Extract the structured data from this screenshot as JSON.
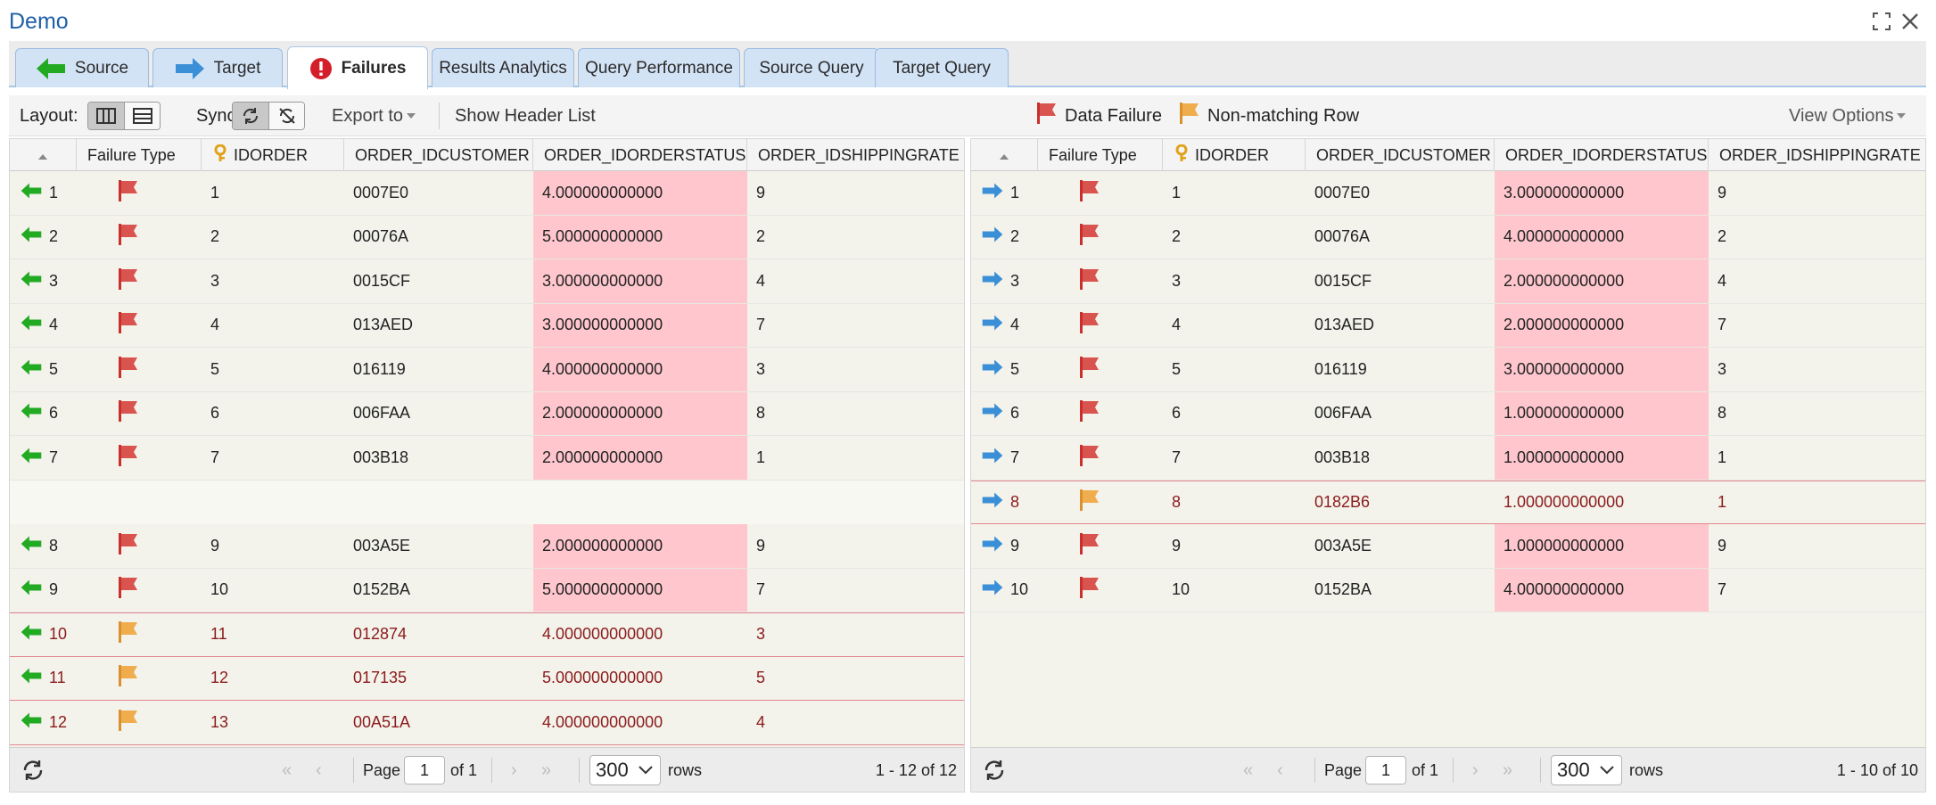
{
  "window": {
    "title": "Demo"
  },
  "tabs": [
    {
      "label": "Source",
      "icon": "arrow-left-green-icon"
    },
    {
      "label": "Target",
      "icon": "arrow-right-blue-icon"
    },
    {
      "label": "Failures",
      "icon": "alert-red-icon",
      "active": true
    },
    {
      "label": "Results Analytics"
    },
    {
      "label": "Query Performance"
    },
    {
      "label": "Source Query"
    },
    {
      "label": "Target Query"
    }
  ],
  "toolbar": {
    "layout_label": "Layout:",
    "sync_label": "Sync:",
    "export_label": "Export to",
    "show_header_label": "Show Header List",
    "legend_data_failure": "Data Failure",
    "legend_nonmatching": "Non-matching Row",
    "view_options_label": "View Options"
  },
  "colors": {
    "data_failure_flag": "#d9534f",
    "nonmatching_flag": "#f0ad4e",
    "failure_cell": "#ffc7cd",
    "nonmatching_text": "#8b1a1a",
    "source_arrow": "#22aa22",
    "target_arrow": "#3b8fd6"
  },
  "columns": [
    "Failure Type",
    "IDORDER",
    "ORDER_IDCUSTOMER",
    "ORDER_IDORDERSTATUS",
    "ORDER_IDSHIPPINGRATE"
  ],
  "source": {
    "rows": [
      {
        "n": "1",
        "type": "data",
        "id": "1",
        "cust": "0007E0",
        "status": "4.000000000000",
        "ship": "9"
      },
      {
        "n": "2",
        "type": "data",
        "id": "2",
        "cust": "00076A",
        "status": "5.000000000000",
        "ship": "2"
      },
      {
        "n": "3",
        "type": "data",
        "id": "3",
        "cust": "0015CF",
        "status": "3.000000000000",
        "ship": "4"
      },
      {
        "n": "4",
        "type": "data",
        "id": "4",
        "cust": "013AED",
        "status": "3.000000000000",
        "ship": "7"
      },
      {
        "n": "5",
        "type": "data",
        "id": "5",
        "cust": "016119",
        "status": "4.000000000000",
        "ship": "3"
      },
      {
        "n": "6",
        "type": "data",
        "id": "6",
        "cust": "006FAA",
        "status": "2.000000000000",
        "ship": "8"
      },
      {
        "n": "7",
        "type": "data",
        "id": "7",
        "cust": "003B18",
        "status": "2.000000000000",
        "ship": "1"
      },
      {
        "gap": true
      },
      {
        "n": "8",
        "type": "data",
        "id": "9",
        "cust": "003A5E",
        "status": "2.000000000000",
        "ship": "9"
      },
      {
        "n": "9",
        "type": "data",
        "id": "10",
        "cust": "0152BA",
        "status": "5.000000000000",
        "ship": "7"
      },
      {
        "n": "10",
        "type": "nonmatch",
        "id": "11",
        "cust": "012874",
        "status": "4.000000000000",
        "ship": "3"
      },
      {
        "n": "11",
        "type": "nonmatch",
        "id": "12",
        "cust": "017135",
        "status": "5.000000000000",
        "ship": "5"
      },
      {
        "n": "12",
        "type": "nonmatch",
        "id": "13",
        "cust": "00A51A",
        "status": "4.000000000000",
        "ship": "4"
      }
    ],
    "footer": {
      "page_label": "Page",
      "page": "1",
      "of_label": "of 1",
      "rows_value": "300",
      "rows_label": "rows",
      "range": "1 - 12 of 12"
    }
  },
  "target": {
    "rows": [
      {
        "n": "1",
        "type": "data",
        "id": "1",
        "cust": "0007E0",
        "status": "3.000000000000",
        "ship": "9"
      },
      {
        "n": "2",
        "type": "data",
        "id": "2",
        "cust": "00076A",
        "status": "4.000000000000",
        "ship": "2"
      },
      {
        "n": "3",
        "type": "data",
        "id": "3",
        "cust": "0015CF",
        "status": "2.000000000000",
        "ship": "4"
      },
      {
        "n": "4",
        "type": "data",
        "id": "4",
        "cust": "013AED",
        "status": "2.000000000000",
        "ship": "7"
      },
      {
        "n": "5",
        "type": "data",
        "id": "5",
        "cust": "016119",
        "status": "3.000000000000",
        "ship": "3"
      },
      {
        "n": "6",
        "type": "data",
        "id": "6",
        "cust": "006FAA",
        "status": "1.000000000000",
        "ship": "8"
      },
      {
        "n": "7",
        "type": "data",
        "id": "7",
        "cust": "003B18",
        "status": "1.000000000000",
        "ship": "1"
      },
      {
        "n": "8",
        "type": "nonmatch",
        "id": "8",
        "cust": "0182B6",
        "status": "1.000000000000",
        "ship": "1"
      },
      {
        "n": "9",
        "type": "data",
        "id": "9",
        "cust": "003A5E",
        "status": "1.000000000000",
        "ship": "9"
      },
      {
        "n": "10",
        "type": "data",
        "id": "10",
        "cust": "0152BA",
        "status": "4.000000000000",
        "ship": "7"
      }
    ],
    "footer": {
      "page_label": "Page",
      "page": "1",
      "of_label": "of 1",
      "rows_value": "300",
      "rows_label": "rows",
      "range": "1 - 10 of 10"
    }
  }
}
